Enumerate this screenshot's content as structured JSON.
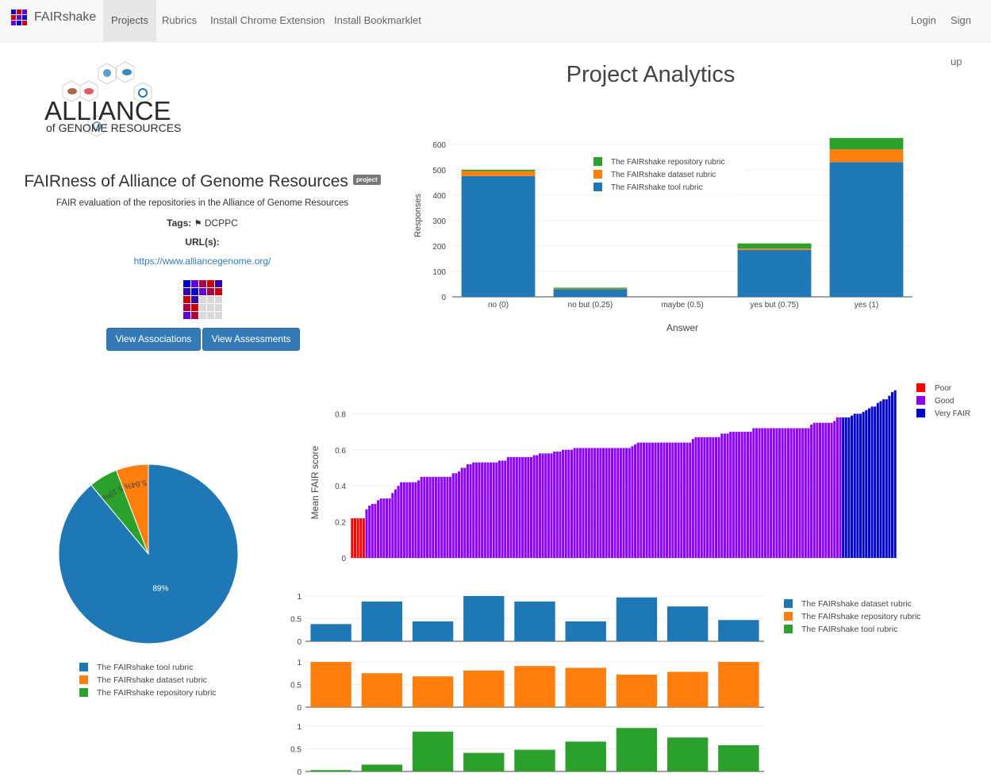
{
  "navbar": {
    "brand": "FAIRshake",
    "items": [
      {
        "label": "Projects",
        "active": true
      },
      {
        "label": "Rubrics"
      },
      {
        "label": "Install Chrome Extension"
      },
      {
        "label": "Install Bookmarklet"
      }
    ],
    "right": [
      "Login",
      "Sign up"
    ]
  },
  "logo": {
    "line1": "ALLIANCE",
    "line2": "of GENOME RESOURCES"
  },
  "project": {
    "title": "FAIRness of Alliance of Genome Resources",
    "badge": "project",
    "description": "FAIR evaluation of the repositories in the Alliance of Genome Resources",
    "tags_label": "Tags:",
    "tag": "DCPPC",
    "urls_label": "URL(s):",
    "url": "https://www.alliancegenome.org/",
    "btn_associations": "View Associations",
    "btn_assessments": "View Assessments"
  },
  "analytics_title": "Project Analytics",
  "colors": {
    "blue": "#1f77b4",
    "orange": "#ff7f0e",
    "green": "#2ca02c",
    "poor": "#ff0000",
    "good": "#8b00ff",
    "veryfair": "#0000cc"
  },
  "chart_data": [
    {
      "type": "bar",
      "stacked": true,
      "categories": [
        "no (0)",
        "no but (0.25)",
        "maybe (0.5)",
        "yes but (0.75)",
        "yes (1)"
      ],
      "series": [
        {
          "name": "The FAIRshake tool rubric",
          "values": [
            475,
            30,
            0,
            185,
            530
          ]
        },
        {
          "name": "The FAIRshake dataset rubric",
          "values": [
            20,
            2,
            0,
            5,
            50
          ]
        },
        {
          "name": "The FAIRshake repository rubric",
          "values": [
            5,
            4,
            0,
            20,
            45
          ]
        }
      ],
      "xlabel": "Answer",
      "ylabel": "Responses",
      "ylim": [
        0,
        640
      ],
      "yticks": [
        0,
        100,
        200,
        300,
        400,
        500,
        600
      ],
      "legend": "top-center"
    },
    {
      "type": "pie",
      "labels": [
        "The FAIRshake tool rubric",
        "The FAIRshake dataset rubric",
        "The FAIRshake repository rubric"
      ],
      "values": [
        89,
        5.84,
        5.19
      ],
      "slice_labels": [
        "89%",
        "5.84%",
        "5.19%"
      ],
      "legend": "bottom"
    },
    {
      "type": "bar",
      "ylabel": "Mean FAIR score",
      "ylim": [
        0,
        0.96
      ],
      "yticks": [
        0,
        0.2,
        0.4,
        0.6,
        0.8
      ],
      "legend_entries": [
        "Poor",
        "Good",
        "Very FAIR"
      ],
      "legend": "top-right",
      "values": [
        0.22,
        0.22,
        0.22,
        0.22,
        0.22,
        0.27,
        0.29,
        0.3,
        0.3,
        0.32,
        0.33,
        0.33,
        0.33,
        0.33,
        0.36,
        0.38,
        0.4,
        0.42,
        0.42,
        0.42,
        0.42,
        0.42,
        0.42,
        0.43,
        0.45,
        0.45,
        0.45,
        0.45,
        0.45,
        0.45,
        0.45,
        0.45,
        0.45,
        0.45,
        0.45,
        0.47,
        0.47,
        0.48,
        0.5,
        0.5,
        0.52,
        0.52,
        0.53,
        0.53,
        0.53,
        0.53,
        0.53,
        0.53,
        0.53,
        0.53,
        0.53,
        0.54,
        0.54,
        0.54,
        0.56,
        0.56,
        0.56,
        0.56,
        0.56,
        0.56,
        0.56,
        0.56,
        0.56,
        0.57,
        0.57,
        0.58,
        0.58,
        0.58,
        0.58,
        0.58,
        0.59,
        0.59,
        0.59,
        0.6,
        0.6,
        0.6,
        0.6,
        0.61,
        0.61,
        0.61,
        0.61,
        0.61,
        0.61,
        0.61,
        0.61,
        0.61,
        0.61,
        0.61,
        0.61,
        0.61,
        0.61,
        0.61,
        0.61,
        0.61,
        0.61,
        0.61,
        0.61,
        0.62,
        0.63,
        0.64,
        0.64,
        0.64,
        0.64,
        0.64,
        0.64,
        0.64,
        0.64,
        0.64,
        0.64,
        0.64,
        0.64,
        0.64,
        0.64,
        0.64,
        0.64,
        0.64,
        0.64,
        0.64,
        0.66,
        0.67,
        0.67,
        0.67,
        0.67,
        0.67,
        0.67,
        0.67,
        0.67,
        0.67,
        0.69,
        0.69,
        0.69,
        0.7,
        0.7,
        0.7,
        0.7,
        0.7,
        0.7,
        0.7,
        0.7,
        0.72,
        0.72,
        0.72,
        0.72,
        0.72,
        0.72,
        0.72,
        0.72,
        0.72,
        0.72,
        0.72,
        0.72,
        0.72,
        0.72,
        0.72,
        0.72,
        0.72,
        0.72,
        0.72,
        0.72,
        0.74,
        0.75,
        0.75,
        0.75,
        0.75,
        0.75,
        0.75,
        0.75,
        0.76,
        0.78,
        0.78,
        0.78,
        0.78,
        0.78,
        0.79,
        0.8,
        0.8,
        0.8,
        0.81,
        0.82,
        0.83,
        0.84,
        0.84,
        0.86,
        0.87,
        0.88,
        0.88,
        0.9,
        0.92,
        0.93
      ],
      "good_from": 5,
      "veryfair_from": 170
    },
    {
      "type": "bar",
      "subplots": 3,
      "series": [
        {
          "name": "The FAIRshake dataset rubric",
          "values": [
            0.38,
            0.88,
            0.44,
            1.0,
            0.88,
            0.44,
            0.97,
            0.77,
            0.47
          ]
        },
        {
          "name": "The FAIRshake repository rubric",
          "values": [
            1.0,
            0.75,
            0.68,
            0.81,
            0.91,
            0.87,
            0.72,
            0.78,
            1.0
          ]
        },
        {
          "name": "The FAIRshake tool rubric",
          "values": [
            0.03,
            0.15,
            0.88,
            0.41,
            0.48,
            0.66,
            0.96,
            0.75,
            0.58
          ]
        }
      ],
      "yticks": [
        "0",
        "0.5",
        "1"
      ],
      "legend": "right"
    }
  ]
}
